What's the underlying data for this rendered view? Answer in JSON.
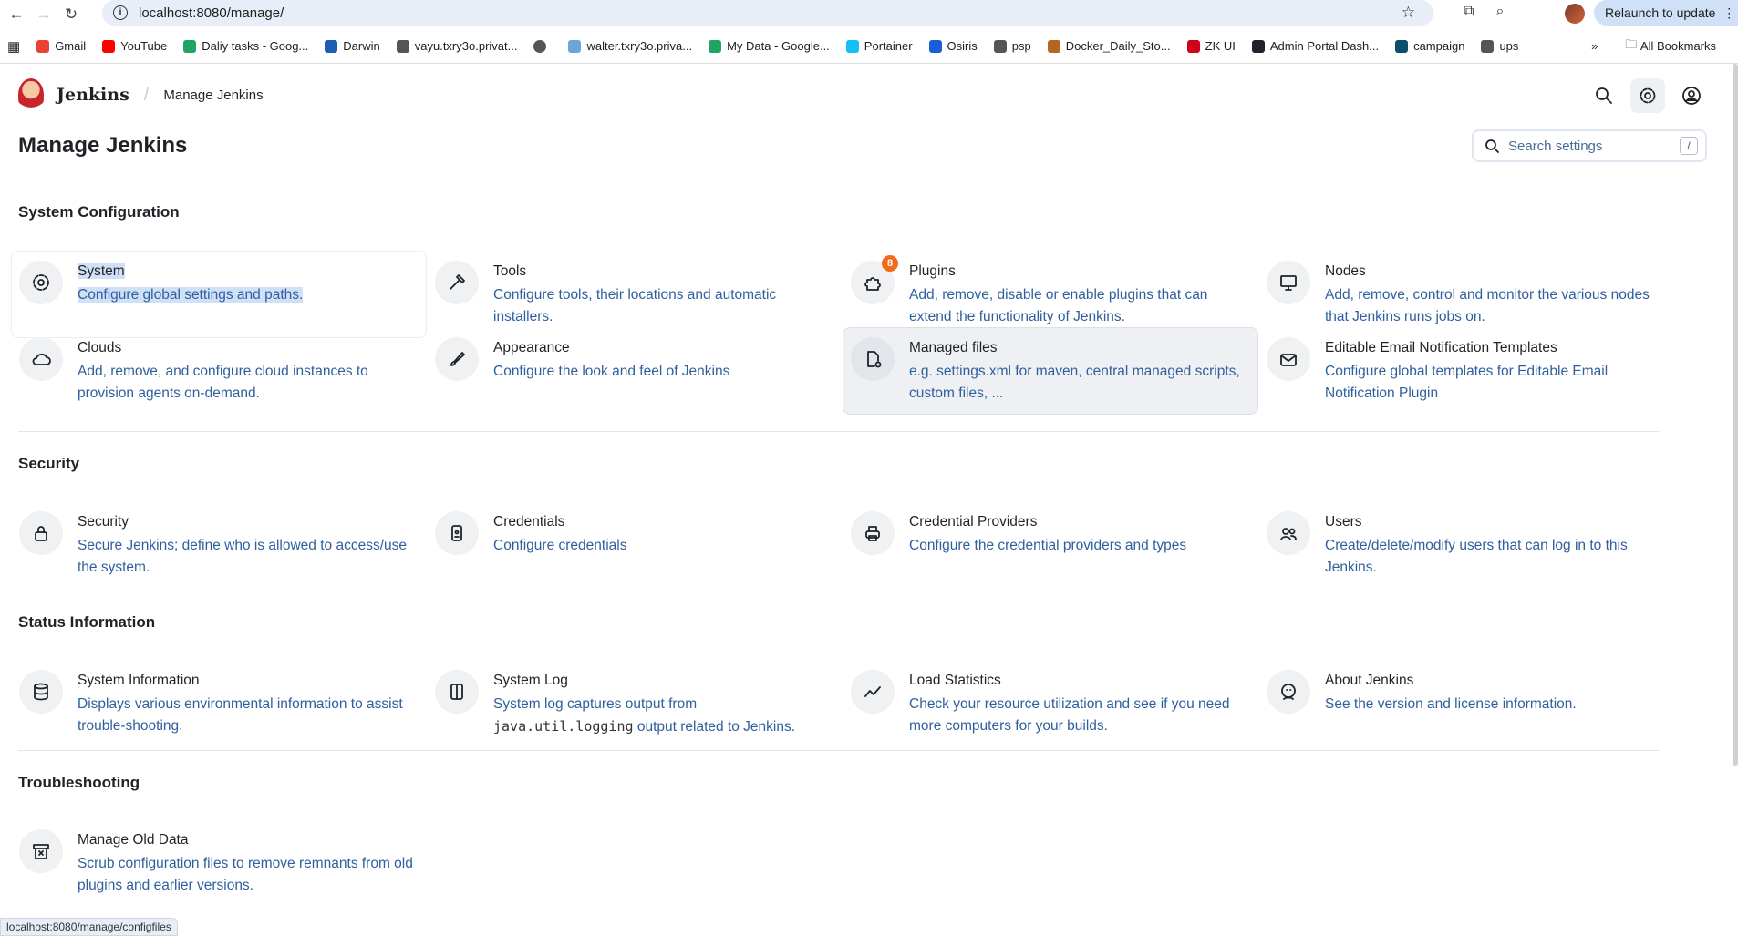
{
  "browser": {
    "url": "localhost:8080/manage/",
    "relaunch": "Relaunch to update",
    "bookmarks": [
      {
        "label": "Gmail",
        "color": "#ea4335"
      },
      {
        "label": "YouTube",
        "color": "#ff0000"
      },
      {
        "label": "Daliy tasks - Goog...",
        "color": "#1fa463"
      },
      {
        "label": "Darwin",
        "color": "#1a5fb4"
      },
      {
        "label": "vayu.txry3o.privat...",
        "color": "#555555"
      },
      {
        "label": "",
        "color": "#555555"
      },
      {
        "label": "walter.txry3o.priva...",
        "color": "#6aa7d8"
      },
      {
        "label": "My Data - Google...",
        "color": "#1fa463"
      },
      {
        "label": "Portainer",
        "color": "#13bef9"
      },
      {
        "label": "Osiris",
        "color": "#1a5fd6"
      },
      {
        "label": "psp",
        "color": "#555555"
      },
      {
        "label": "Docker_Daily_Sto...",
        "color": "#b5651d"
      },
      {
        "label": "ZK UI",
        "color": "#d0021b"
      },
      {
        "label": "Admin Portal Dash...",
        "color": "#20232a"
      },
      {
        "label": "campaign",
        "color": "#0b4f6c"
      },
      {
        "label": "ups",
        "color": "#555555"
      }
    ],
    "all_bookmarks": "All Bookmarks",
    "status_url": "localhost:8080/manage/configfiles"
  },
  "header": {
    "brand": "Jenkins",
    "breadcrumb": "Manage Jenkins"
  },
  "page": {
    "title": "Manage Jenkins",
    "search_placeholder": "Search settings",
    "search_shortcut": "/"
  },
  "sections": [
    {
      "title": "System Configuration",
      "items": [
        {
          "title": "System",
          "desc": "Configure global settings and paths."
        },
        {
          "title": "Tools",
          "desc": "Configure tools, their locations and automatic installers."
        },
        {
          "title": "Plugins",
          "desc": "Add, remove, disable or enable plugins that can extend the functionality of Jenkins.",
          "badge": "8"
        },
        {
          "title": "Nodes",
          "desc": "Add, remove, control and monitor the various nodes that Jenkins runs jobs on."
        },
        {
          "title": "Clouds",
          "desc": "Add, remove, and configure cloud instances to provision agents on-demand."
        },
        {
          "title": "Appearance",
          "desc": "Configure the look and feel of Jenkins"
        },
        {
          "title": "Managed files",
          "desc": "e.g. settings.xml for maven, central managed scripts, custom files, ..."
        },
        {
          "title": "Editable Email Notification Templates",
          "desc": "Configure global templates for Editable Email Notification Plugin"
        }
      ]
    },
    {
      "title": "Security",
      "items": [
        {
          "title": "Security",
          "desc": "Secure Jenkins; define who is allowed to access/use the system."
        },
        {
          "title": "Credentials",
          "desc": "Configure credentials"
        },
        {
          "title": "Credential Providers",
          "desc": "Configure the credential providers and types"
        },
        {
          "title": "Users",
          "desc": "Create/delete/modify users that can log in to this Jenkins."
        }
      ]
    },
    {
      "title": "Status Information",
      "items": [
        {
          "title": "System Information",
          "desc": "Displays various environmental information to assist trouble-shooting."
        },
        {
          "title": "System Log",
          "desc_pre": "System log captures output from ",
          "desc_code": "java.util.logging",
          "desc_post": " output related to Jenkins."
        },
        {
          "title": "Load Statistics",
          "desc": "Check your resource utilization and see if you need more computers for your builds."
        },
        {
          "title": "About Jenkins",
          "desc": "See the version and license information."
        }
      ]
    },
    {
      "title": "Troubleshooting",
      "items": [
        {
          "title": "Manage Old Data",
          "desc": "Scrub configuration files to remove remnants from old plugins and earlier versions."
        }
      ]
    }
  ]
}
